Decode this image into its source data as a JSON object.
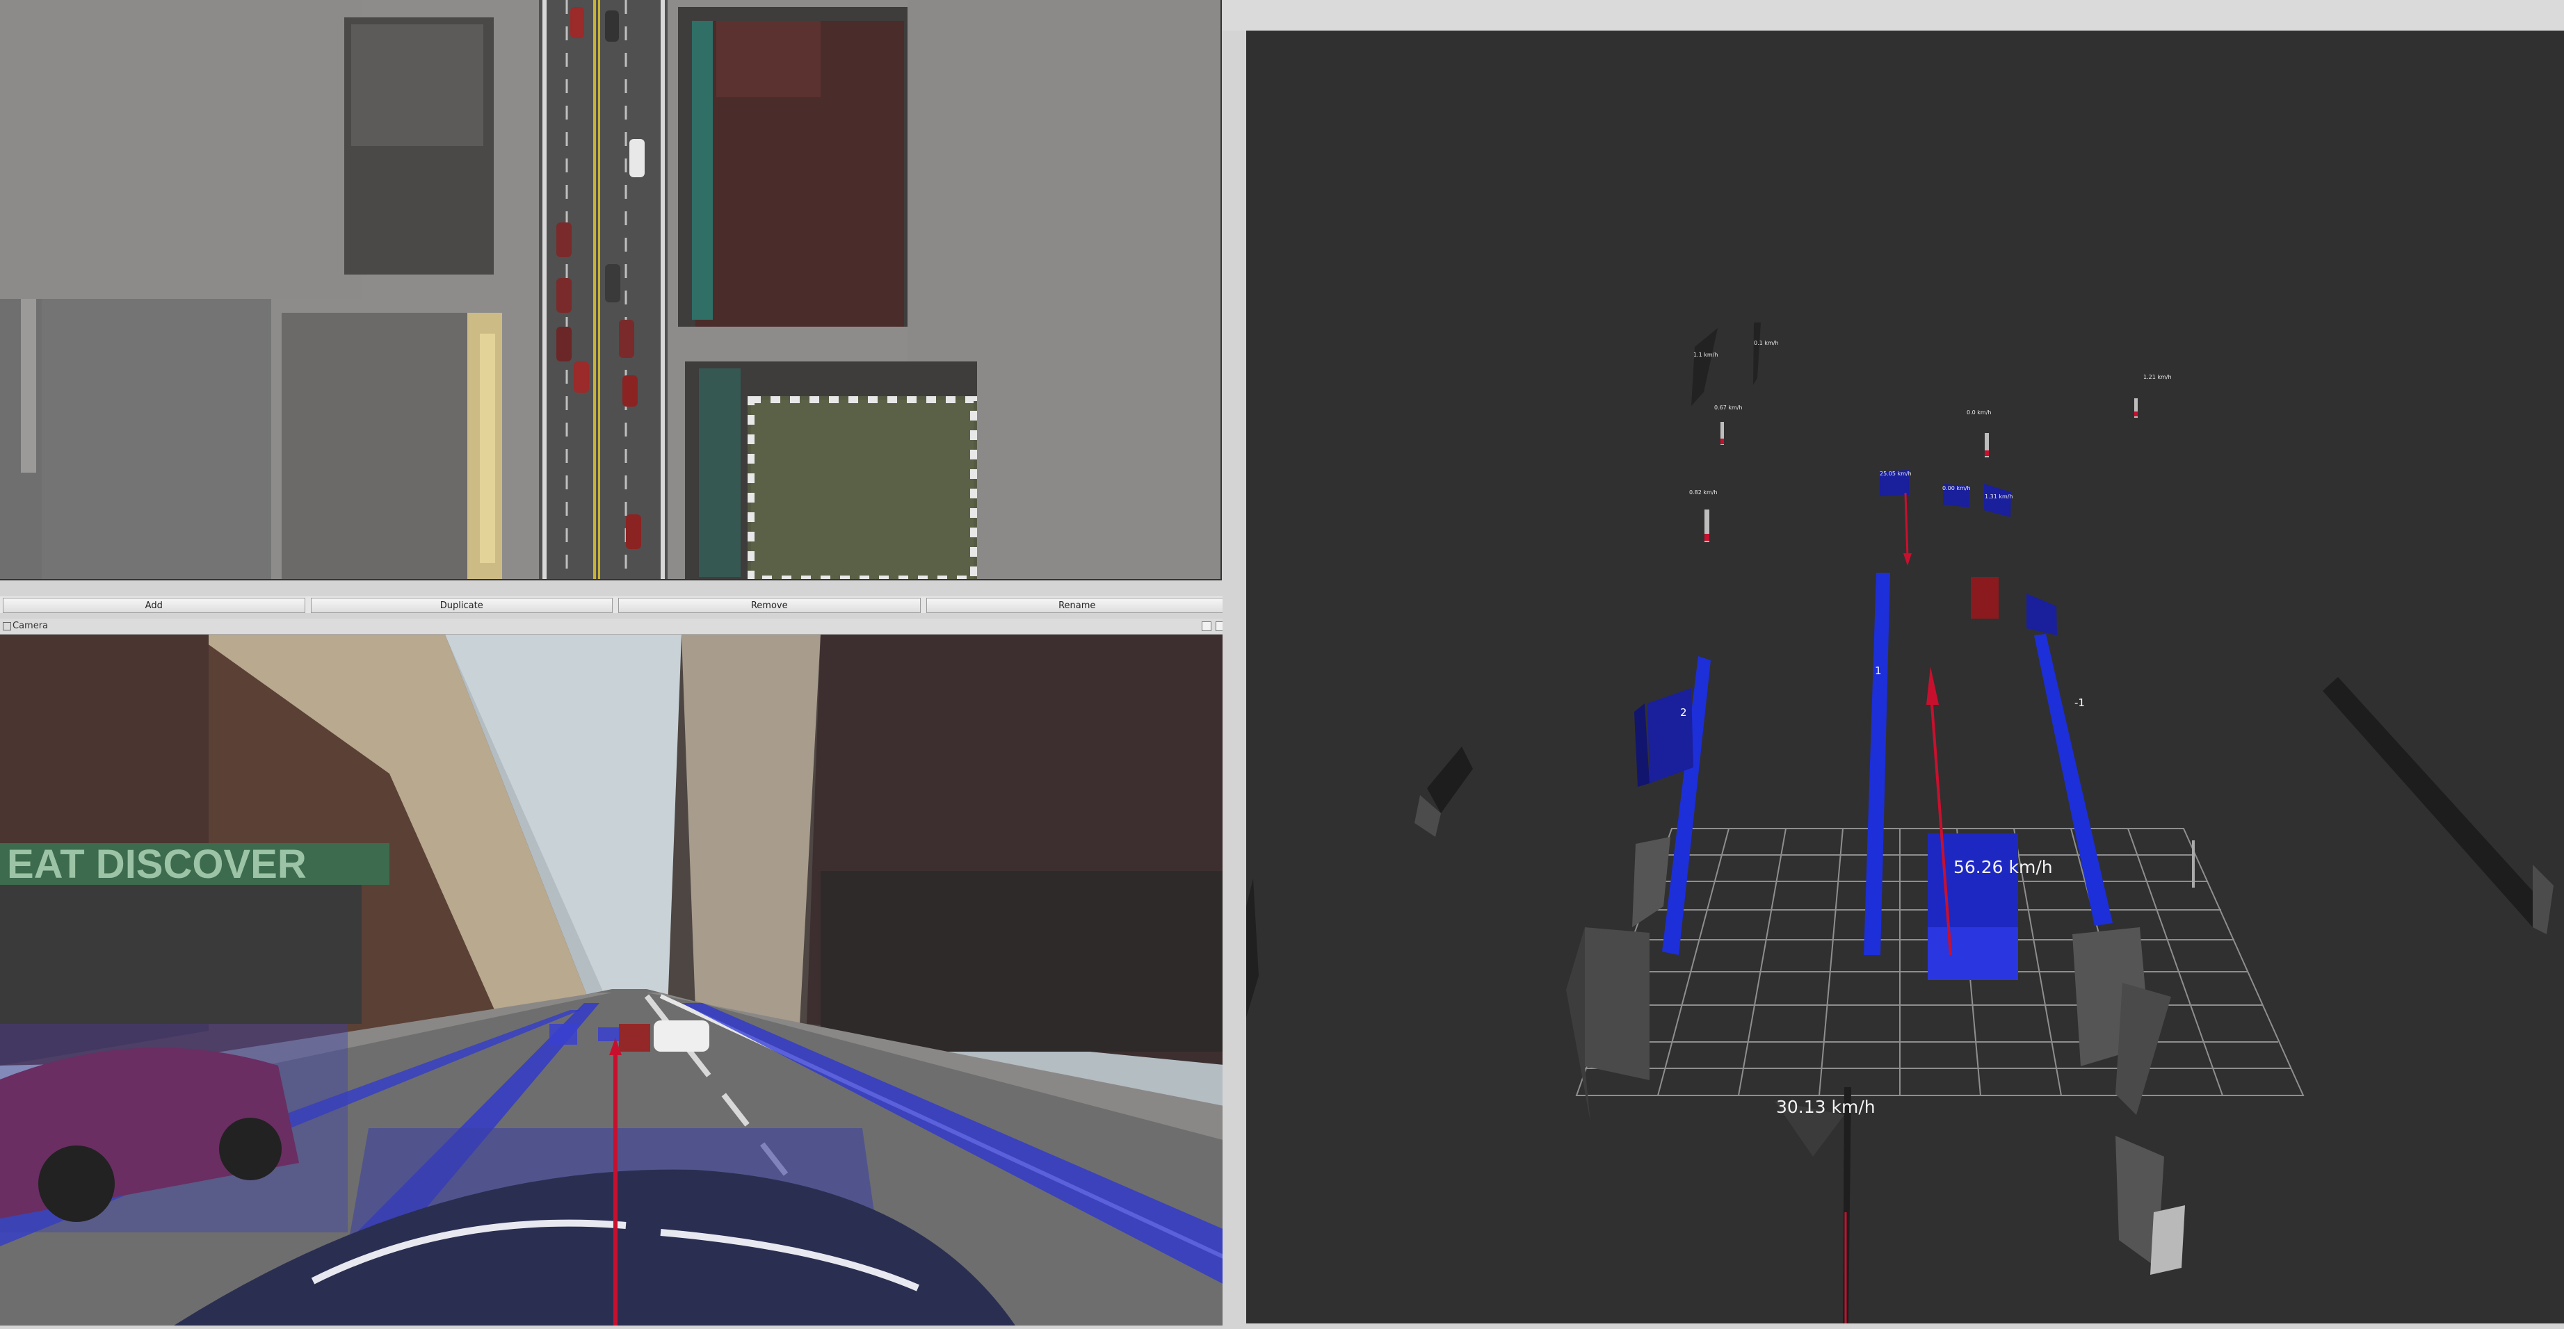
{
  "toolbar": {
    "add_label": "Add",
    "duplicate_label": "Duplicate",
    "remove_label": "Remove",
    "rename_label": "Rename"
  },
  "camera_panel": {
    "title": "Camera",
    "sign_text": "EAT DISCOVER"
  },
  "viz": {
    "ego_speed": "30.13  km/h",
    "lead_speed": "56.26  km/h",
    "lane_labels": [
      "2",
      "1",
      "-1"
    ],
    "object_speeds": [
      "1.1 km/h",
      "0.1 km/h",
      "1.21 km/h",
      "0.67 km/h",
      "0.0 km/h",
      "0.82  km/h",
      "25.05  km/h",
      "0.00  km/h",
      "1.31  km/h"
    ]
  },
  "colors": {
    "lane_blue": "#1d2fd8",
    "object_blue": "#1a1f9c",
    "object_red": "#8b1a1e",
    "velocity_arrow": "#c8102e",
    "viewport_bg": "#303030",
    "static_obstacle": "#4a4a4a"
  }
}
